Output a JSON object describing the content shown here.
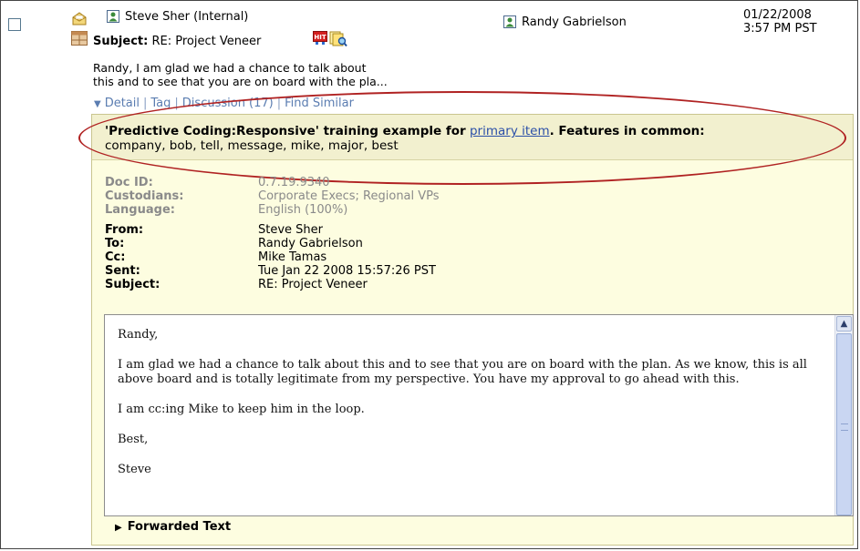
{
  "message": {
    "sender": "Steve Sher (Internal)",
    "recipient": "Randy Gabrielson",
    "date": "01/22/2008",
    "time": "3:57 PM PST",
    "subject_label": "Subject:",
    "subject": "RE: Project Veneer",
    "snippet_line1": "Randy, I am glad we had a chance to talk about",
    "snippet_line2": "this and to see that you are on board with the pla...",
    "hit_badge": "HIT"
  },
  "links": {
    "detail": "Detail",
    "tag": "Tag",
    "discussion": "Discussion (17)",
    "find_similar": "Find Similar",
    "separator": "|"
  },
  "training": {
    "prefix": "'Predictive Coding:Responsive' training example for",
    "link": "primary item",
    "suffix": ". Features in common:",
    "features": "company, bob, tell, message, mike, major, best"
  },
  "meta_grey": [
    {
      "key": "Doc ID:",
      "value": "0.7.19.9340"
    },
    {
      "key": "Custodians:",
      "value": "Corporate Execs; Regional VPs"
    },
    {
      "key": "Language:",
      "value": "English (100%)"
    }
  ],
  "meta_header": [
    {
      "key": "From:",
      "value": "Steve Sher"
    },
    {
      "key": "To:",
      "value": "Randy Gabrielson"
    },
    {
      "key": "Cc:",
      "value": "Mike Tamas"
    },
    {
      "key": "Sent:",
      "value": "Tue Jan 22 2008 15:57:26 PST"
    },
    {
      "key": "Subject:",
      "value": "RE: Project Veneer"
    }
  ],
  "body": {
    "p1": "Randy,",
    "p2": "I am glad we had a chance to talk about this and to see that you are on board with the plan. As we know, this is all above board and is totally legitimate from my perspective. You have my approval to go ahead with this.",
    "p3": "I am cc:ing Mike to keep him in the loop.",
    "p4": "Best,",
    "p5": "Steve"
  },
  "forwarded": "Forwarded Text",
  "icons": {
    "envelope": "envelope-open-icon",
    "grid": "table-grid-icon",
    "person": "person-card-icon",
    "hit": "hit-badge-icon",
    "docs": "documents-search-icon",
    "detail_arrow": "triangle-down-icon",
    "forwarded_arrow": "triangle-right-icon"
  },
  "colors": {
    "panel_bg": "#fdfde0",
    "training_bg": "#f2f0cf",
    "link_blue": "#5b7db1",
    "ellipse_red": "#b02222"
  }
}
